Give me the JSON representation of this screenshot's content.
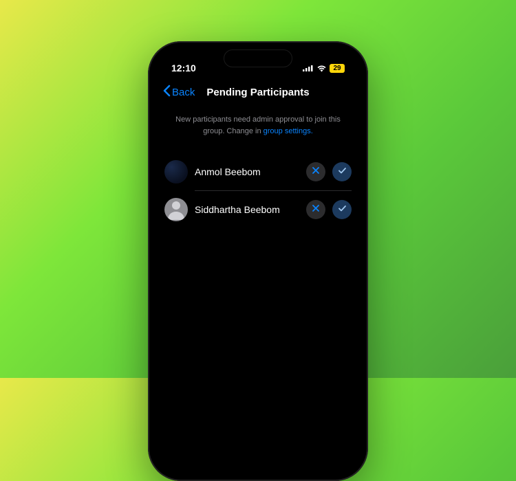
{
  "status": {
    "time": "12:10",
    "battery": "29"
  },
  "nav": {
    "back": "Back",
    "title": "Pending Participants"
  },
  "info": {
    "text": "New participants need admin approval to join this group. Change in ",
    "link": "group settings."
  },
  "participants": [
    {
      "name": "Anmol Beebom",
      "avatar": "dark"
    },
    {
      "name": "Siddhartha Beebom",
      "avatar": "default"
    }
  ],
  "colors": {
    "accent": "#0a84ff",
    "battery": "#ffd60a"
  }
}
